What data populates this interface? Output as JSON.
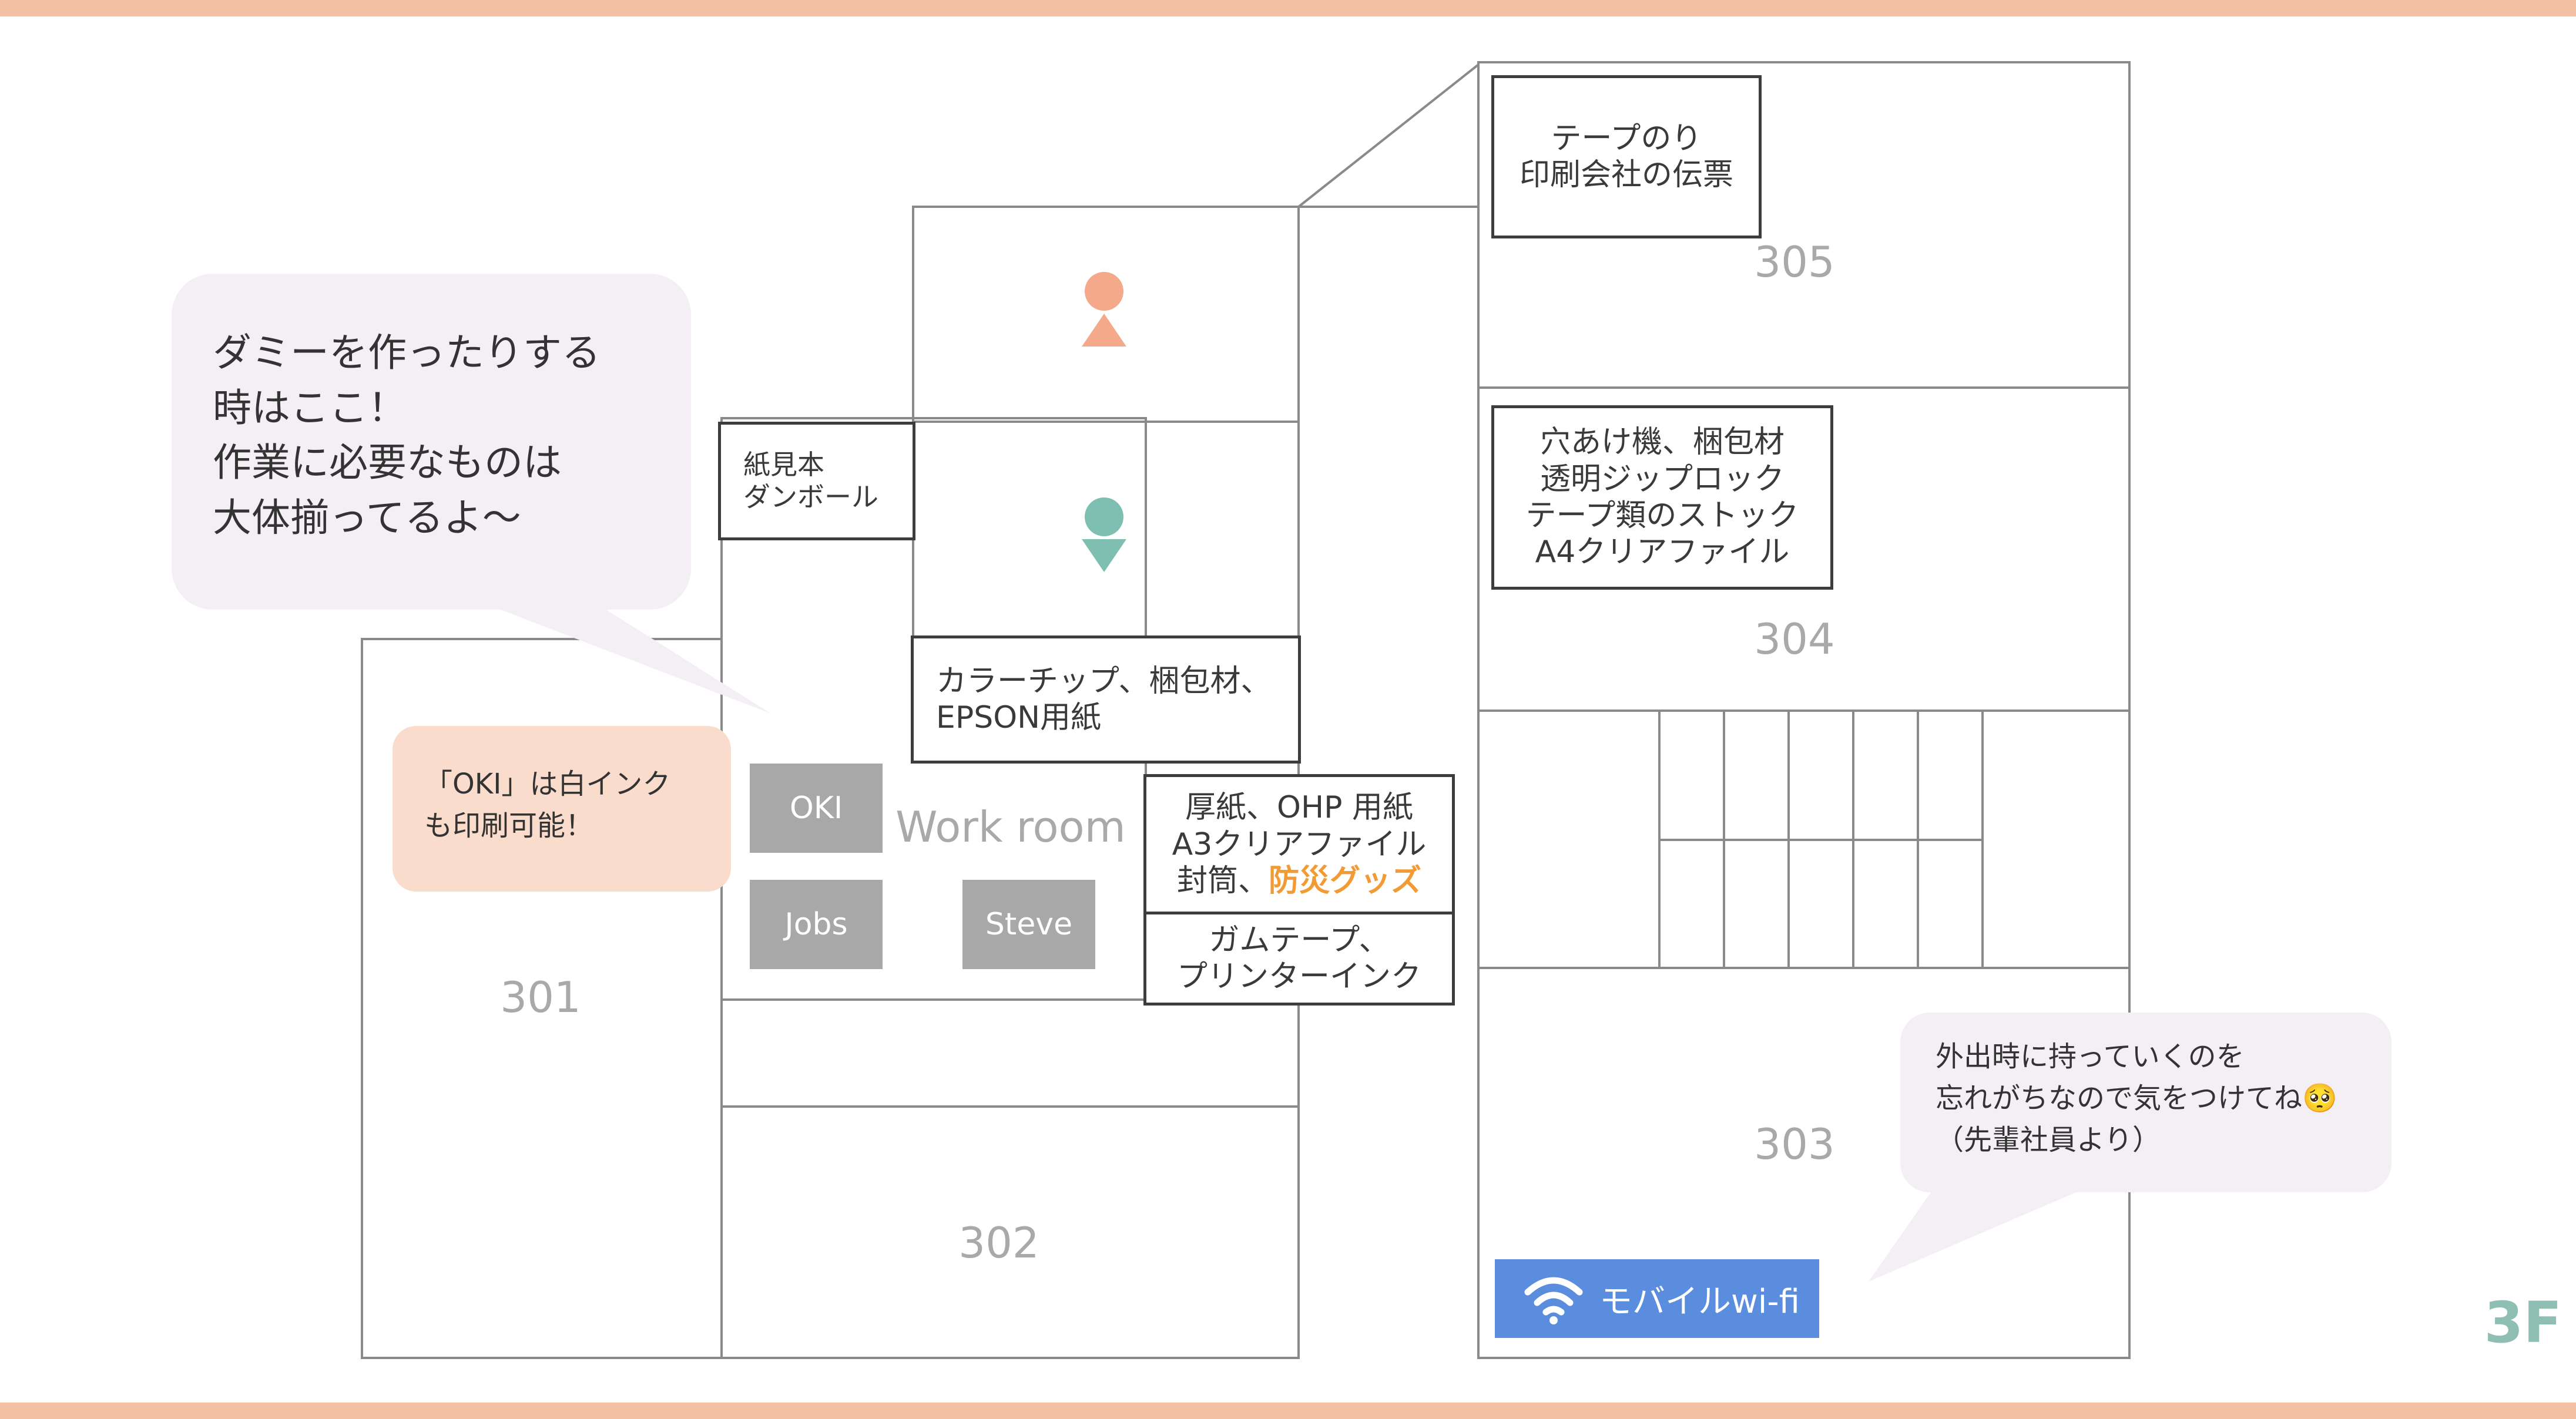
{
  "floor": "3F",
  "rooms": {
    "r301": "301",
    "r302": "302",
    "r303": "303",
    "r304": "304",
    "r305": "305",
    "work_room": "Work room"
  },
  "storage": {
    "tape_glue": [
      "テープのり",
      "印刷会社の伝票"
    ],
    "punch_packing": [
      "穴あけ機、梱包材",
      "透明ジップロック",
      "テープ類のストック",
      "A4クリアファイル"
    ],
    "paper_samples": [
      "紙見本",
      "ダンボール"
    ],
    "color_chips": [
      "カラーチップ、梱包材、",
      "EPSON用紙"
    ],
    "thick_paper": {
      "line1": "厚紙、OHP 用紙",
      "line2": "A3クリアファイル",
      "line3_prefix": "封筒、",
      "line3_highlight": "防災グッズ"
    },
    "gum_tape": [
      "ガムテープ、",
      "プリンターインク"
    ]
  },
  "printers": {
    "oki": "OKI",
    "jobs": "Jobs",
    "steve": "Steve"
  },
  "bubbles": {
    "dummy": [
      "ダミーを作ったりする",
      "時はここ！",
      "作業に必要なものは",
      "大体揃ってるよ〜"
    ],
    "oki_note": [
      "「OKI」は白インク",
      "も印刷可能！"
    ],
    "outing": [
      "外出時に持っていくのを",
      "忘れがちなので気をつけてね🥺",
      "（先輩社員より）"
    ]
  },
  "wifi": {
    "label": "モバイルwi-fi",
    "icon": "wifi-icon"
  },
  "restrooms": {
    "women": "female-restroom-icon",
    "men": "male-restroom-icon"
  },
  "colors": {
    "top_bottom_bar": "#f5c1a4",
    "floor_label": "#8fbfb3",
    "female_icon": "#f4a98a",
    "male_icon": "#7fbfb1",
    "bubble_lavender": "#f4eef5",
    "bubble_peach": "#fadccd",
    "wifi_blue": "#5b8ddf",
    "highlight_orange": "#f29b35"
  }
}
